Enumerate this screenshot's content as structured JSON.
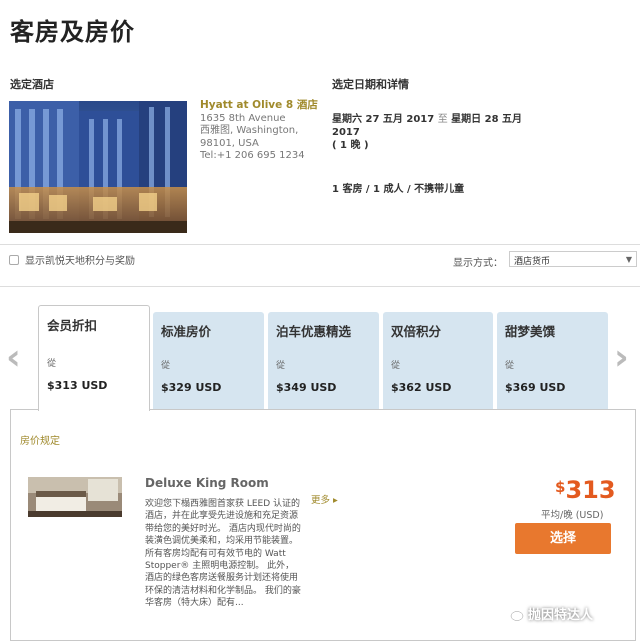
{
  "page": {
    "title": "客房及房价"
  },
  "hotel_section": {
    "label": "选定酒店",
    "name": "Hyatt at Olive 8 酒店",
    "address_line1": "1635 8th Avenue",
    "address_line2": "西雅图, Washington,",
    "address_line3": "98101, USA",
    "phone": "Tel:+1 206 695 1234"
  },
  "dates_section": {
    "label": "选定日期和详情",
    "checkin": "星期六 27 五月 2017",
    "to": "至",
    "checkout": "星期日 28 五月",
    "checkout_year": "2017",
    "nights": "( 1 晚 )",
    "occupancy": "1 客房 / 1 成人 / 不携带儿童"
  },
  "options": {
    "points_label": "显示凯悦天地积分与奖励",
    "display_label": "显示方式：",
    "currency_selected": "酒店货币"
  },
  "tabs": [
    {
      "title": "会员折扣",
      "from": "從",
      "price": "$313 USD",
      "active": true
    },
    {
      "title": "标准房价",
      "from": "從",
      "price": "$329 USD",
      "active": false
    },
    {
      "title": "泊车优惠精选",
      "from": "從",
      "price": "$349 USD",
      "active": false
    },
    {
      "title": "双倍积分",
      "from": "從",
      "price": "$362 USD",
      "active": false
    },
    {
      "title": "甜梦美馔",
      "from": "從",
      "price": "$369 USD",
      "active": false
    }
  ],
  "rates": {
    "rules_label": "房价规定",
    "room": {
      "name": "Deluxe King Room",
      "description": "欢迎您下榻西雅图首家获 LEED 认证的酒店，并在此享受先进设施和充足资源带给您的美好时光。 酒店内现代时尚的装潢色调优美柔和，均采用节能装置。 所有客房均配有可有效节电的 Watt Stopper® 主照明电源控制。 此外，酒店的绿色客房送餐服务计划还将使用环保的清洁材料和化学制品。 我们的豪华客房（特大床）配有...",
      "more": "更多",
      "currency_symbol": "$",
      "price": "313",
      "per_night": "平均/晚 (USD)",
      "select_label": "选择"
    }
  },
  "watermark": {
    "text": "抛因特达人"
  },
  "colors": {
    "accent_gold": "#a08a2c",
    "price_orange": "#e35a1f",
    "button_orange": "#e8782e",
    "tab_blue": "#d6e5f0"
  },
  "icons": {
    "nav_left": "chevron-left-icon",
    "nav_right": "chevron-right-icon",
    "more": "caret-right-icon",
    "dropdown": "chevron-down-icon"
  }
}
